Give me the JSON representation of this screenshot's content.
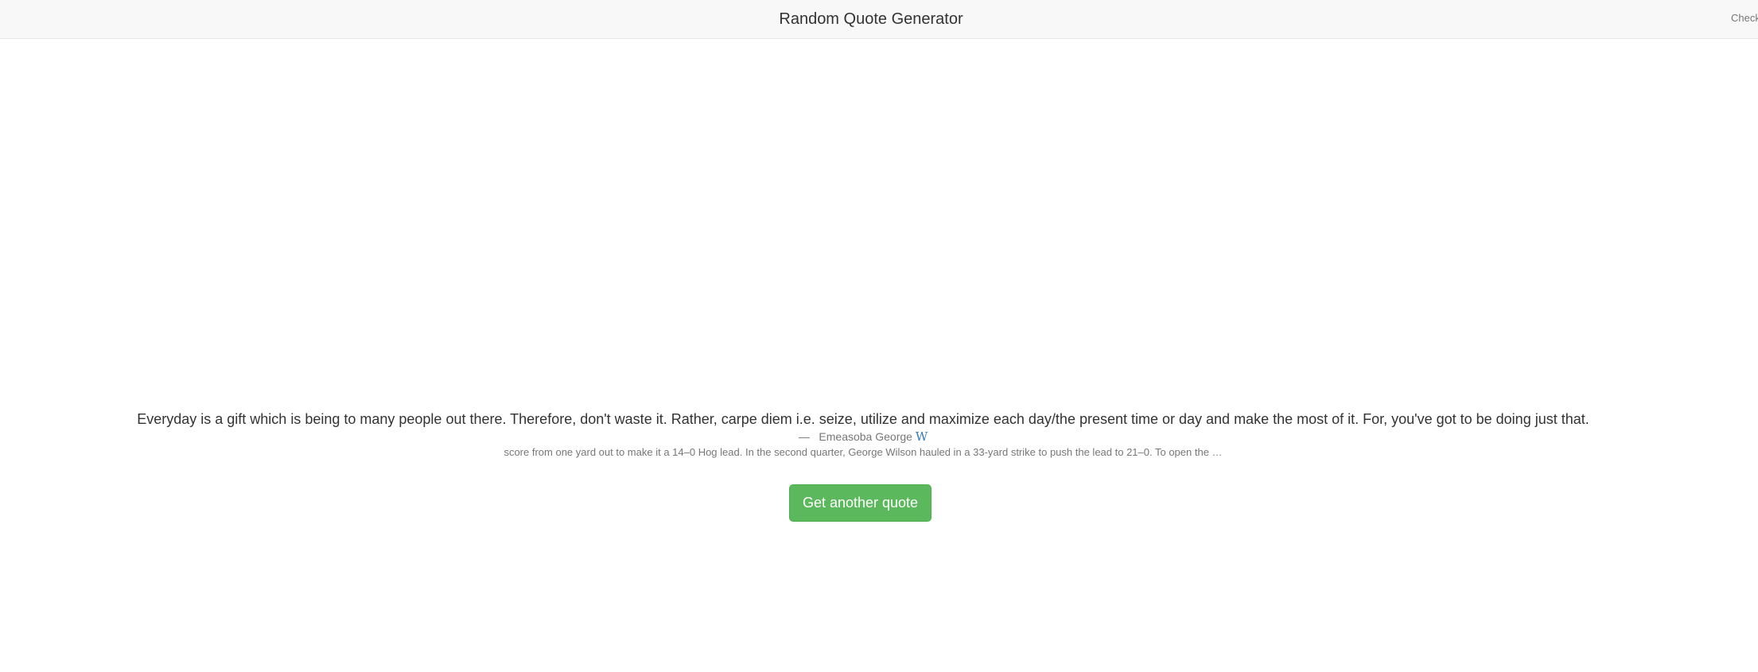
{
  "navbar": {
    "title": "Random Quote Generator",
    "right_text": "Check"
  },
  "quote": {
    "text": "Everyday is a gift which is being to many people out there. Therefore, don't waste it. Rather, carpe diem i.e. seize, utilize and maximize each day/the present time or day and make the most of it. For, you've got to be doing just that.",
    "dash": "—",
    "author": "Emeasoba George",
    "wiki_icon": "W",
    "snippet": "score from one yard out to make it a 14–0 Hog lead. In the second quarter, George Wilson hauled in a 33-yard strike to push the lead to 21–0. To open the …"
  },
  "actions": {
    "new_quote_label": "Get another quote"
  },
  "colors": {
    "navbar_bg": "#f8f8f8",
    "button_bg": "#5cb85c",
    "link": "#337ab7"
  }
}
